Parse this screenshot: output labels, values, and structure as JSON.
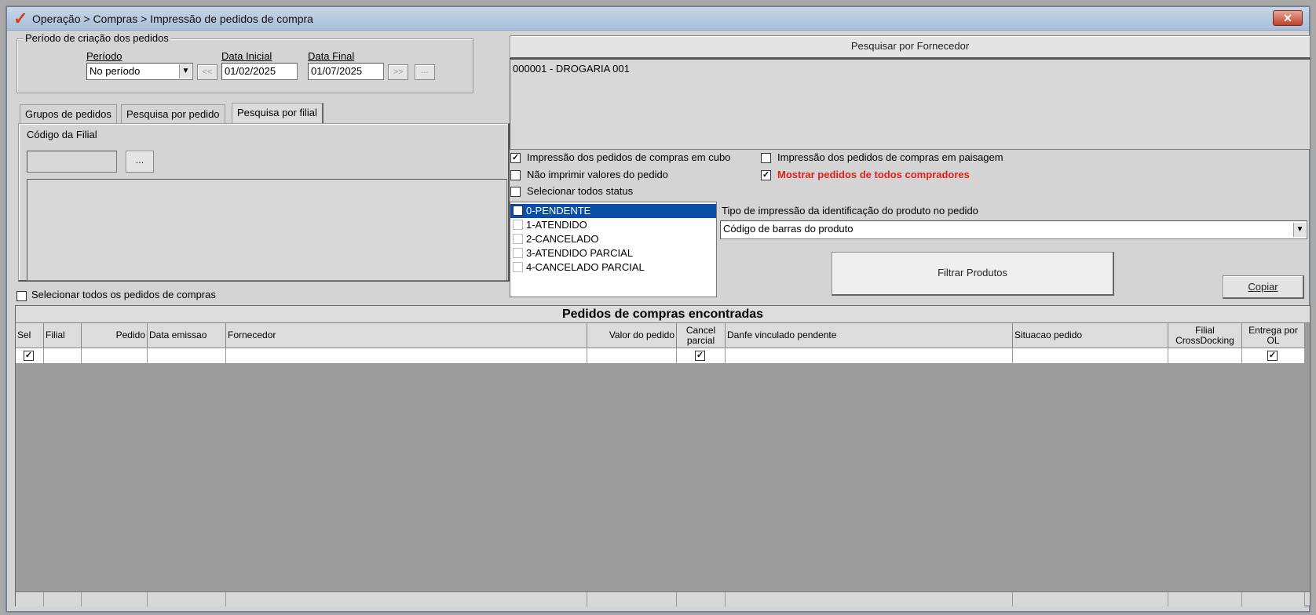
{
  "window": {
    "title": "Operação > Compras > Impressão de pedidos de compra",
    "close_label": "✕"
  },
  "periodo_group": {
    "legend": "Período de criação dos pedidos",
    "periodo_label": "Período",
    "periodo_value": "No período",
    "data_inicial_label": "Data Inicial",
    "data_inicial_value": "01/02/2025",
    "data_final_label": "Data Final",
    "data_final_value": "01/07/2025",
    "prev_label": "<<",
    "next_label": ">>",
    "more_label": "..."
  },
  "tabs": [
    {
      "label": "Grupos de pedidos"
    },
    {
      "label": "Pesquisa por pedido"
    },
    {
      "label": "Pesquisa por filial"
    }
  ],
  "filial_panel": {
    "codigo_label": "Código da Filial",
    "codigo_value": "",
    "browse_label": "..."
  },
  "select_all_orders": {
    "label": "Selecionar todos os pedidos de compras",
    "checked": false
  },
  "fornecedor": {
    "button_label": "Pesquisar por Fornecedor",
    "items": [
      "000001 - DROGARIA 001"
    ]
  },
  "options": {
    "cubo": {
      "label": "Impressão dos pedidos de compras em cubo",
      "checked": true
    },
    "paisagem": {
      "label": "Impressão dos pedidos de compras em paisagem",
      "checked": false
    },
    "nao_imprimir": {
      "label": "Não imprimir valores do pedido",
      "checked": false
    },
    "todos_compradores": {
      "label": "Mostrar pedidos de todos compradores",
      "checked": true,
      "color": "#e0201a"
    },
    "todos_status": {
      "label": "Selecionar todos status",
      "checked": false
    }
  },
  "status_list": [
    {
      "label": "0-PENDENTE",
      "checked": true,
      "selected": true
    },
    {
      "label": "1-ATENDIDO",
      "checked": false,
      "selected": false
    },
    {
      "label": "2-CANCELADO",
      "checked": false,
      "selected": false
    },
    {
      "label": "3-ATENDIDO PARCIAL",
      "checked": false,
      "selected": false
    },
    {
      "label": "4-CANCELADO PARCIAL",
      "checked": false,
      "selected": false
    }
  ],
  "tipo_impressao": {
    "label": "Tipo de impressão da identificação do produto no pedido",
    "value": "Código de barras do produto"
  },
  "filtrar_button": "Filtrar Produtos",
  "copiar_button": "Copiar",
  "grid": {
    "title": "Pedidos de compras encontradas",
    "columns": [
      {
        "label": "Sel",
        "align": "left"
      },
      {
        "label": "Filial",
        "align": "left"
      },
      {
        "label": "Pedido",
        "align": "right"
      },
      {
        "label": "Data emissao",
        "align": "left"
      },
      {
        "label": "Fornecedor",
        "align": "left"
      },
      {
        "label": "Valor do pedido",
        "align": "right"
      },
      {
        "label": "Cancel parcial",
        "align": "center"
      },
      {
        "label": "Danfe vinculado pendente",
        "align": "left"
      },
      {
        "label": "Situacao pedido",
        "align": "left"
      },
      {
        "label": "Filial CrossDocking",
        "align": "center"
      },
      {
        "label": "Entrega por OL",
        "align": "center"
      }
    ],
    "rows": [
      {
        "cells": [
          "☑",
          "",
          "",
          "",
          "",
          "",
          "☑",
          "",
          "",
          "",
          "☑"
        ]
      }
    ]
  },
  "colors": {
    "selection": "#0a4ea8",
    "accent_red": "#e0201a",
    "grid_background": "#9c9c9c"
  }
}
